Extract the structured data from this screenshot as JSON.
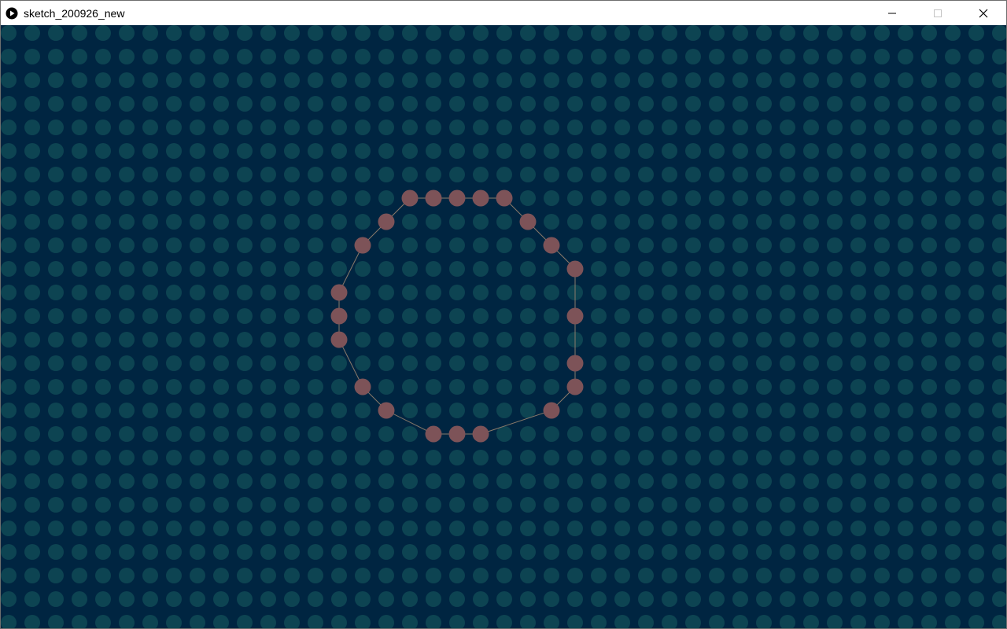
{
  "window": {
    "title": "sketch_200926_new",
    "app_icon": "processing-play-icon",
    "controls": {
      "minimize_icon": "minimize-icon",
      "maximize_icon": "maximize-icon",
      "close_icon": "close-icon"
    }
  },
  "sketch": {
    "colors": {
      "background": "#002541",
      "grid_dot": "#0d4452",
      "ring_dot": "#7d5358",
      "ring_line": "#8a7a6a"
    },
    "grid": {
      "columns": 43,
      "rows": 26
    },
    "ring": {
      "cells": [
        [
          17,
          7
        ],
        [
          18,
          7
        ],
        [
          19,
          7
        ],
        [
          20,
          7
        ],
        [
          21,
          7
        ],
        [
          22,
          8
        ],
        [
          23,
          9
        ],
        [
          24,
          10
        ],
        [
          24,
          12
        ],
        [
          24,
          14
        ],
        [
          24,
          15
        ],
        [
          23,
          16
        ],
        [
          20,
          17
        ],
        [
          19,
          17
        ],
        [
          18,
          17
        ],
        [
          16,
          16
        ],
        [
          15,
          15
        ],
        [
          14,
          13
        ],
        [
          14,
          12
        ],
        [
          14,
          11
        ],
        [
          15,
          9
        ],
        [
          16,
          8
        ]
      ]
    }
  }
}
